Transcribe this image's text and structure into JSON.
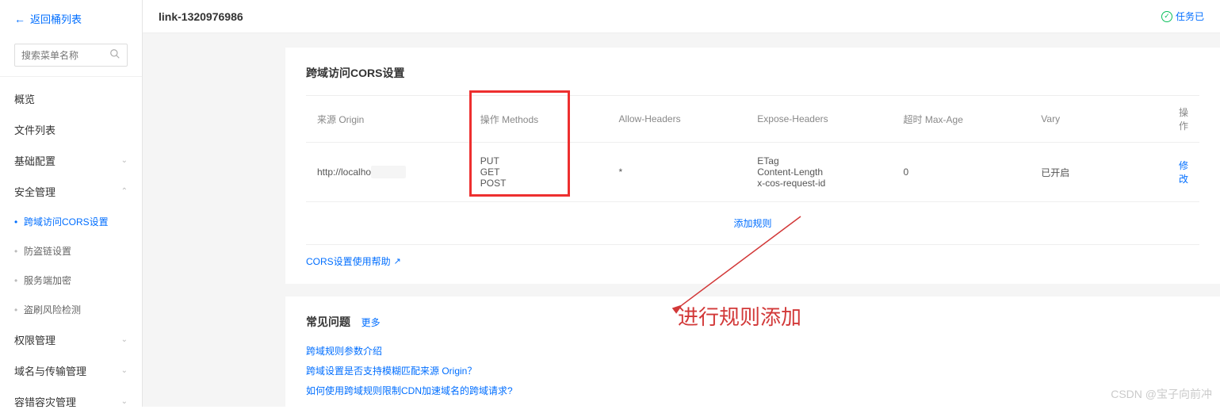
{
  "sidebar": {
    "back_label": "返回桶列表",
    "search_placeholder": "搜索菜单名称",
    "items": [
      {
        "label": "概览",
        "type": "top"
      },
      {
        "label": "文件列表",
        "type": "top"
      },
      {
        "label": "基础配置",
        "type": "top",
        "expandable": true
      },
      {
        "label": "安全管理",
        "type": "top",
        "expandable": true,
        "expanded": true
      },
      {
        "label": "跨域访问CORS设置",
        "type": "sub",
        "active": true
      },
      {
        "label": "防盗链设置",
        "type": "sub"
      },
      {
        "label": "服务端加密",
        "type": "sub"
      },
      {
        "label": "盗刷风险检测",
        "type": "sub"
      },
      {
        "label": "权限管理",
        "type": "top",
        "expandable": true
      },
      {
        "label": "域名与传输管理",
        "type": "top",
        "expandable": true
      },
      {
        "label": "容错容灾管理",
        "type": "top",
        "expandable": true
      }
    ]
  },
  "header": {
    "bucket_name": "link-1320976986",
    "task_status": "任务已"
  },
  "cors": {
    "title": "跨域访问CORS设置",
    "columns": {
      "origin": "来源 Origin",
      "methods": "操作 Methods",
      "allow_headers": "Allow-Headers",
      "expose_headers": "Expose-Headers",
      "max_age": "超时 Max-Age",
      "vary": "Vary",
      "action": "操作"
    },
    "rows": [
      {
        "origin": "http://localhos.....3",
        "methods": "PUT\nGET\nPOST",
        "allow_headers": "*",
        "expose_headers": "ETag\nContent-Length\nx-cos-request-id",
        "max_age": "0",
        "vary": "已开启",
        "action": "修改"
      }
    ],
    "add_rule": "添加规则",
    "help_link": "CORS设置使用帮助"
  },
  "faq": {
    "title": "常见问题",
    "more": "更多",
    "items": [
      "跨域规则参数介绍",
      "跨域设置是否支持模糊匹配来源 Origin？",
      "如何使用跨域规则限制CDN加速域名的跨域请求?"
    ]
  },
  "annotation": {
    "text": "进行规则添加"
  },
  "watermark": "CSDN @宝子向前冲"
}
